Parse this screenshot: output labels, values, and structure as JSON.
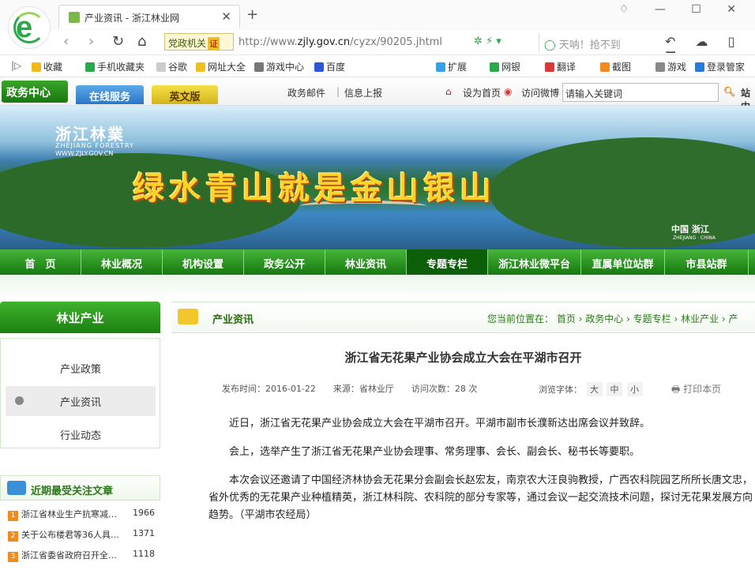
{
  "browser": {
    "tab_title": "产业资讯 - 浙江林业网",
    "new_tab": "+",
    "close": "✕",
    "party_label": "党政机关",
    "party_badge": "证",
    "url_prefix": "http://www.",
    "url_domain": "zjly.gov.cn",
    "url_path": "/cyzx/90205.jhtml",
    "search_placeholder": "天呐！抢不到",
    "window_controls": "♢ — ☐ ✕",
    "tools": "↶ ☁ ▯ ☰"
  },
  "bookmarks": [
    {
      "label": "收藏",
      "color": "#f2b81c"
    },
    {
      "label": "手机收藏夹",
      "color": "#2aa84a"
    },
    {
      "label": "谷歌",
      "color": "#cccccc"
    },
    {
      "label": "网址大全",
      "color": "#f0c020"
    },
    {
      "label": "游戏中心",
      "color": "#777777"
    },
    {
      "label": "百度",
      "color": "#2a57d8"
    },
    {
      "label": "扩展",
      "color": "#36a2e6"
    },
    {
      "label": "网银",
      "color": "#2aa84a"
    },
    {
      "label": "翻译",
      "color": "#d83a3a"
    },
    {
      "label": "截图",
      "color": "#f08c1e"
    },
    {
      "label": "游戏",
      "color": "#888888"
    },
    {
      "label": "登录管家",
      "color": "#2a7ad8"
    }
  ],
  "site": {
    "gov_center": "政务中心",
    "online": "在线服务",
    "english": "英文版",
    "mail": "政务邮件",
    "report": "信息上报",
    "set_home": "设为首页",
    "weibo": "访问微博",
    "search_value": "请输入关键词",
    "search_btn": "站内",
    "brand": "浙江林業",
    "brand_en": "ZHEJIANG FORESTRY",
    "brand_url": "WWW.ZJLY.GOV.CN",
    "slogan": "绿水青山就是金山银山",
    "china_zj": "中国 浙江",
    "china_zj_en": "ZHEJIANG · CHINA",
    "nav": [
      "首　页",
      "林业概况",
      "机构设置",
      "政务公开",
      "林业资讯",
      "专题专栏",
      "浙江林业微平台",
      "直属单位站群",
      "市县站群"
    ],
    "active_nav": 5
  },
  "sidebar": {
    "title": "林业产业",
    "items": [
      "产业政策",
      "产业资讯",
      "行业动态"
    ],
    "active": 1,
    "hot_title": "近期最受关注文章",
    "hot": [
      {
        "n": "1",
        "t": "浙江省林业生产抗寒减…",
        "c": "1966"
      },
      {
        "n": "2",
        "t": "关于公布楼君等36人具…",
        "c": "1371"
      },
      {
        "n": "3",
        "t": "浙江省委省政府召开全…",
        "c": "1118"
      }
    ]
  },
  "article": {
    "section": "产业资讯",
    "location": "您当前位置在： 首页 › 政务中心 › 专题专栏 › 林业产业 › 产",
    "title": "浙江省无花果产业协会成立大会在平湖市召开",
    "meta": "发布时间：2016-01-22　　来源：省林业厅　　访问次数：28 次",
    "font_label": "浏览字体：",
    "font_big": "大",
    "font_mid": "中",
    "font_small": "小",
    "print": "🖶 打印本页",
    "paragraphs": [
      "近日，浙江省无花果产业协会成立大会在平湖市召开。平湖市副市长濮新达出席会议并致辞。",
      "会上，选举产生了浙江省无花果产业协会理事、常务理事、会长、副会长、秘书长等要职。",
      "本次会议还邀请了中国经济林协会无花果分会副会长赵宏友，南京农大汪良驹教授，广西农科院园艺所所长唐文忠，省外优秀的无花果产业种植精英，浙江林科院、农科院的部分专家等，通过会议一起交流技术问题，探讨无花果发展方向趋势。（平湖市农经局）"
    ]
  }
}
